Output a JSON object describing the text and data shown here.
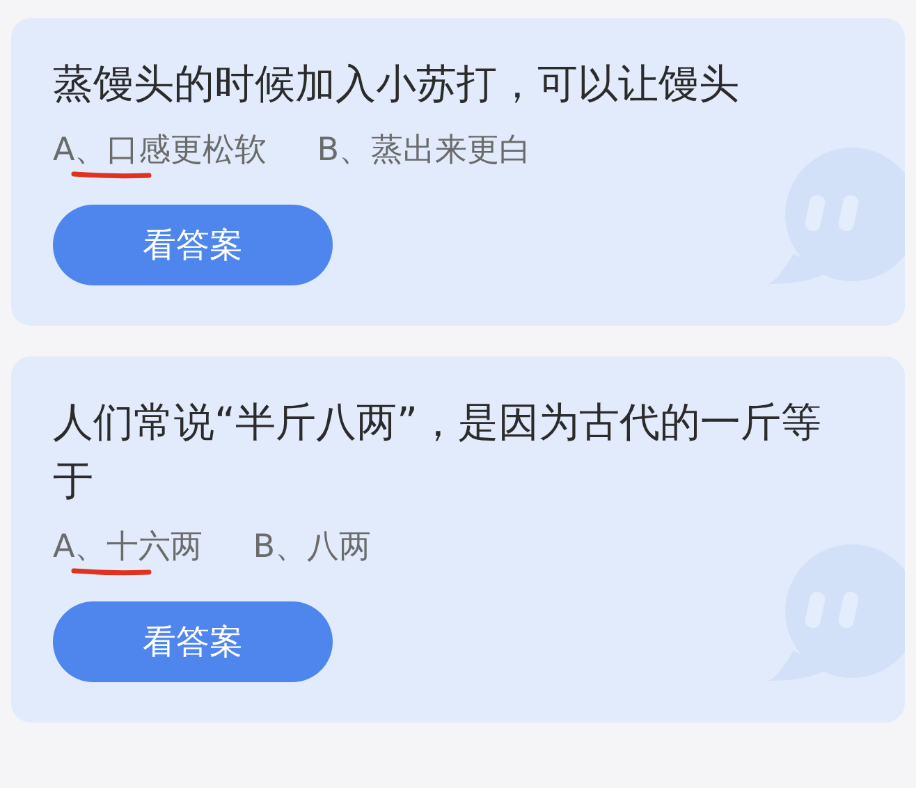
{
  "questions": [
    {
      "question": "蒸馒头的时候加入小苏打，可以让馒头",
      "options": [
        {
          "text": "A、口感更松软",
          "underlined": true
        },
        {
          "text": "B、蒸出来更白",
          "underlined": false
        }
      ],
      "button": "看答案"
    },
    {
      "question": "人们常说“半斤八两”，是因为古代的一斤等于",
      "options": [
        {
          "text": "A、十六两",
          "underlined": true
        },
        {
          "text": "B、八两",
          "underlined": false
        }
      ],
      "button": "看答案"
    }
  ]
}
